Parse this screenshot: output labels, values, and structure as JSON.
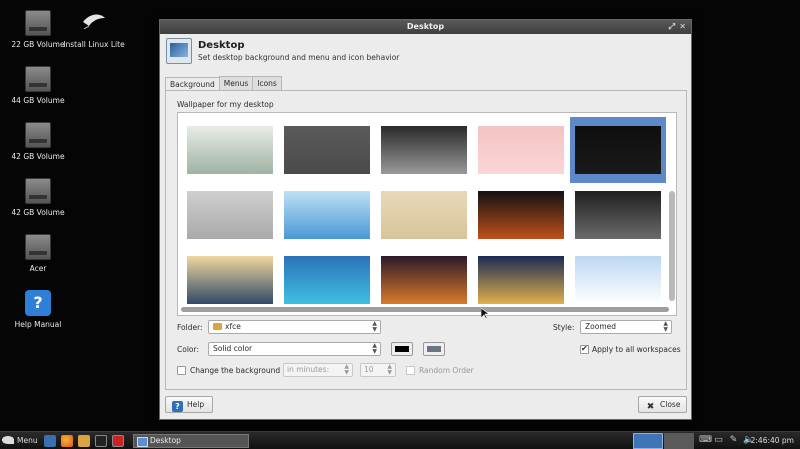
{
  "desktop": {
    "icons": [
      {
        "label": "22 GB Volume",
        "icon": "drive-icon"
      },
      {
        "label": "Install Linux Lite",
        "icon": "linuxlite-feather-icon"
      },
      {
        "label": "44 GB Volume",
        "icon": "drive-icon"
      },
      {
        "label": "42 GB Volume",
        "icon": "drive-icon"
      },
      {
        "label": "42 GB Volume",
        "icon": "drive-icon"
      },
      {
        "label": "Acer",
        "icon": "drive-icon"
      },
      {
        "label": "Help Manual",
        "icon": "help-icon"
      }
    ]
  },
  "window": {
    "title": "Desktop",
    "header_title": "Desktop",
    "header_subtitle": "Set desktop background and menu and icon behavior",
    "tabs": [
      "Background",
      "Menus",
      "Icons"
    ],
    "active_tab": "Background",
    "wallpaper_label": "Wallpaper for my desktop",
    "thumbnails": [
      {
        "name": "misty-shore",
        "c1": "#e8ece6",
        "c2": "#9fb3a4"
      },
      {
        "name": "grey-linuxlite",
        "c1": "#5a5a5a",
        "c2": "#4a4a4a"
      },
      {
        "name": "dark-waves",
        "c1": "#2a2a2a",
        "c2": "#9a9a9a"
      },
      {
        "name": "pink-feather",
        "c1": "#f4c3c3",
        "c2": "#f9d6d6"
      },
      {
        "name": "black-linuxlite",
        "c1": "#0e0e0e",
        "c2": "#1a1a1a"
      },
      {
        "name": "grey-feather",
        "c1": "#cfcfcf",
        "c2": "#a9a9a9"
      },
      {
        "name": "blue-feather",
        "c1": "#bfe0f3",
        "c2": "#4a98d6"
      },
      {
        "name": "sand-feather",
        "c1": "#e8d9b8",
        "c2": "#d8c49a"
      },
      {
        "name": "orange-feather",
        "c1": "#111111",
        "c2": "#c0501a"
      },
      {
        "name": "dark-linuxlite",
        "c1": "#202020",
        "c2": "#6a6a6a"
      },
      {
        "name": "lake-boat",
        "c1": "#f0d7a0",
        "c2": "#2f4a66"
      },
      {
        "name": "rock-sea",
        "c1": "#2c72b8",
        "c2": "#3ec0e0"
      },
      {
        "name": "stadium-night",
        "c1": "#2b1a2a",
        "c2": "#d97a2b"
      },
      {
        "name": "city-night",
        "c1": "#1b2b56",
        "c2": "#e0b04a"
      },
      {
        "name": "snow-cabin",
        "c1": "#bcd7f2",
        "c2": "#ffffff"
      }
    ],
    "selected_thumbnail": 4,
    "folder_label": "Folder:",
    "folder_value": "xfce",
    "style_label": "Style:",
    "style_value": "Zoomed",
    "color_label": "Color:",
    "color_value": "Solid color",
    "color1": "#000000",
    "color2": "#6b7280",
    "apply_all_label": "Apply to all workspaces",
    "apply_all_checked": true,
    "change_bg_label": "Change the background",
    "interval_unit": "in minutes:",
    "interval_value": "10",
    "random_order_label": "Random Order",
    "help_label": "Help",
    "close_label": "Close"
  },
  "taskbar": {
    "menu_label": "Menu",
    "task_label": "Desktop",
    "clock": "2:46:40 pm"
  }
}
